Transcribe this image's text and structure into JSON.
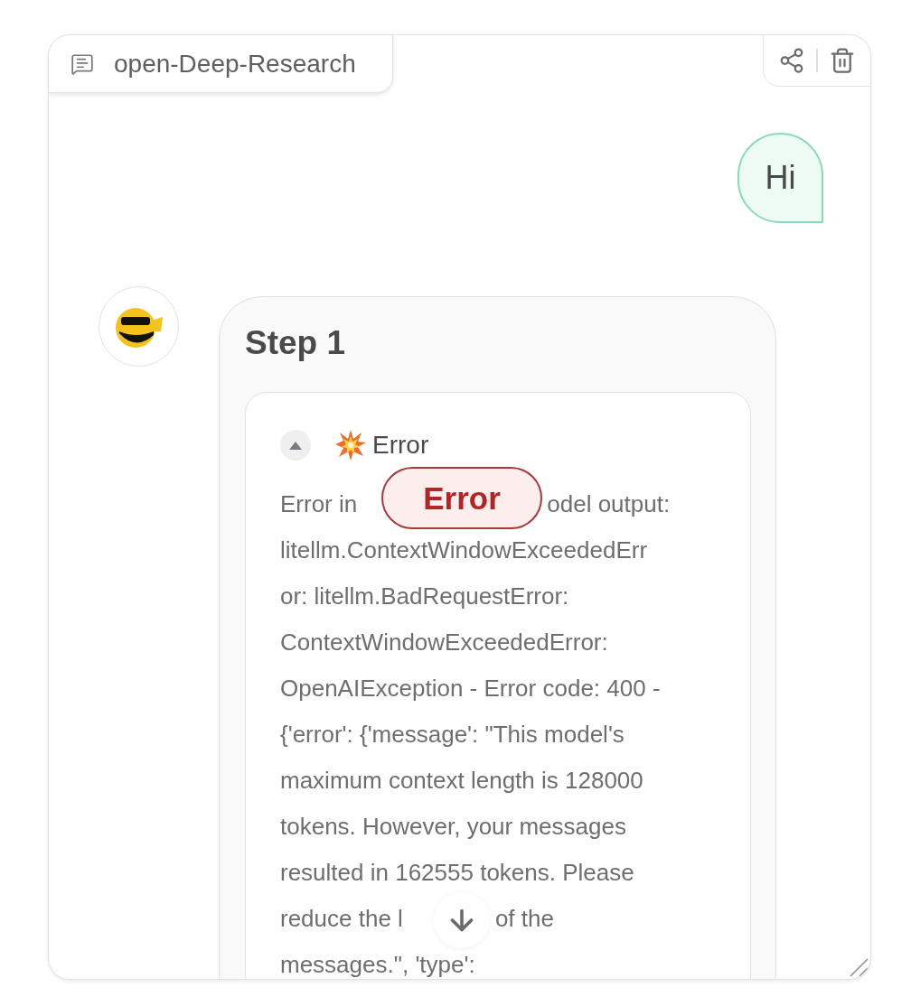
{
  "conversation": {
    "title": "open-Deep-Research"
  },
  "messages": [
    {
      "kind": "user",
      "text": "Hi"
    },
    {
      "kind": "assistant",
      "step": {
        "title": "Step 1",
        "log": {
          "expanded": true,
          "label": "Error",
          "badge": "Error",
          "lines": [
            [
              "Error in",
              "odel output:"
            ],
            [
              "litellm.ContextWindowExceededErr"
            ],
            [
              "or: litellm.BadRequestError:"
            ],
            [
              "ContextWindowExceededError:"
            ],
            [
              "OpenAIException - Error code: 400 -"
            ],
            [
              "{'error': {'message': \"This model's"
            ],
            [
              "maximum context length is 128000"
            ],
            [
              "tokens. However, your messages"
            ],
            [
              "resulted in 162555 tokens. Please"
            ],
            [
              "reduce the l",
              "of the"
            ],
            [
              "messages.\", 'type':"
            ]
          ]
        }
      }
    }
  ]
}
